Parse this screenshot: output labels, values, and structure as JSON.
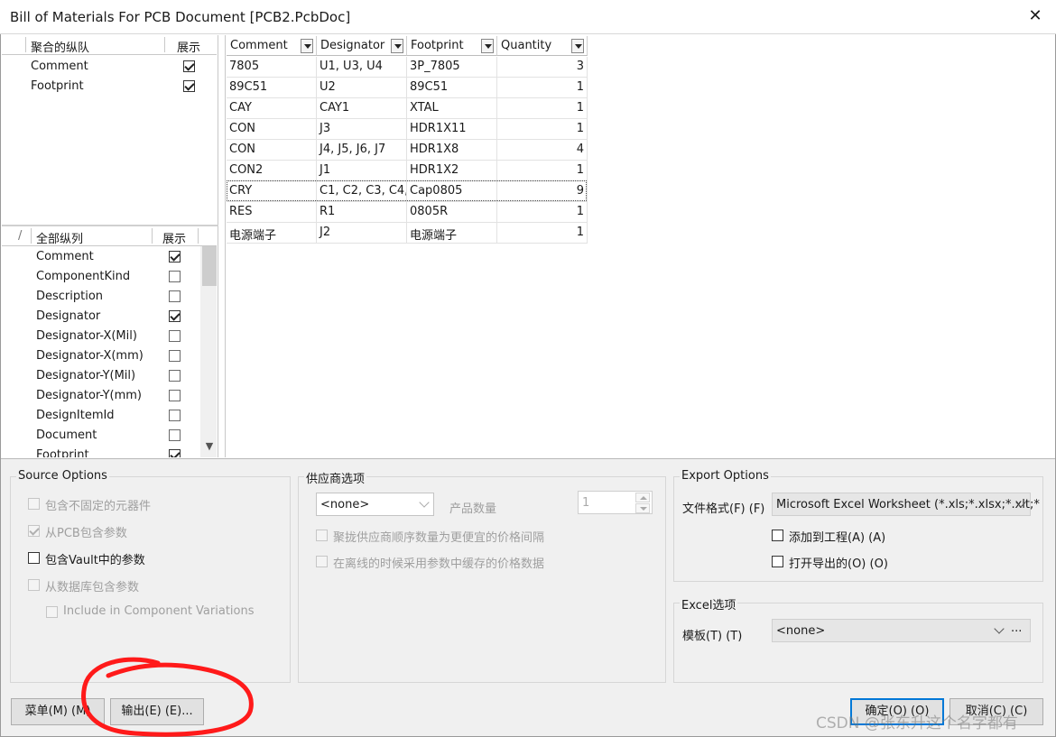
{
  "window": {
    "title": "Bill of Materials For PCB Document [PCB2.PcbDoc]",
    "close_glyph": "✕"
  },
  "aggregated_columns": {
    "header_name": "聚合的纵队",
    "header_show": "展示",
    "items": [
      {
        "label": "Comment",
        "checked": true
      },
      {
        "label": "Footprint",
        "checked": true
      }
    ]
  },
  "all_columns": {
    "sort_glyph": "/",
    "header_name": "全部纵列",
    "header_show": "展示",
    "items": [
      {
        "label": "Comment",
        "checked": true
      },
      {
        "label": "ComponentKind",
        "checked": false
      },
      {
        "label": "Description",
        "checked": false
      },
      {
        "label": "Designator",
        "checked": true
      },
      {
        "label": "Designator-X(Mil)",
        "checked": false
      },
      {
        "label": "Designator-X(mm)",
        "checked": false
      },
      {
        "label": "Designator-Y(Mil)",
        "checked": false
      },
      {
        "label": "Designator-Y(mm)",
        "checked": false
      },
      {
        "label": "DesignItemId",
        "checked": false
      },
      {
        "label": "Document",
        "checked": false
      },
      {
        "label": "Footprint",
        "checked": true
      }
    ]
  },
  "grid": {
    "columns": [
      "Comment",
      "Designator",
      "Footprint",
      "Quantity"
    ],
    "selected_row": 6,
    "rows": [
      [
        "7805",
        "U1, U3, U4",
        "3P_7805",
        "3"
      ],
      [
        "89C51",
        "U2",
        "89C51",
        "1"
      ],
      [
        "CAY",
        "CAY1",
        "XTAL",
        "1"
      ],
      [
        "CON",
        "J3",
        "HDR1X11",
        "1"
      ],
      [
        "CON",
        "J4, J5, J6, J7",
        "HDR1X8",
        "4"
      ],
      [
        "CON2",
        "J1",
        "HDR1X2",
        "1"
      ],
      [
        "CRY",
        "C1, C2, C3, C4,",
        "Cap0805",
        "9"
      ],
      [
        "RES",
        "R1",
        "0805R",
        "1"
      ],
      [
        "电源端子",
        "J2",
        "电源端子",
        "1"
      ]
    ]
  },
  "source_options": {
    "title": "Source Options",
    "opt1": "包含不固定的元器件",
    "opt2": "从PCB包含参数",
    "opt3": "包含Vault中的参数",
    "opt4": "从数据库包含参数",
    "opt5": "Include in Component Variations"
  },
  "supplier_options": {
    "title": "供应商选项",
    "combo_value": "<none>",
    "qty_label": "产品数量",
    "qty_value": "1",
    "opt1": "聚拢供应商顺序数量为更便宜的价格间隔",
    "opt2": "在离线的时候采用参数中缓存的价格数据"
  },
  "export_options": {
    "title": "Export Options",
    "format_label": "文件格式(F) (F)",
    "format_value": "Microsoft Excel Worksheet (*.xls;*.xlsx;*.xlt;*",
    "add_to_project": "添加到工程(A) (A)",
    "open_exported": "打开导出的(O) (O)"
  },
  "excel_options": {
    "title": "Excel选项",
    "template_label": "模板(T) (T)",
    "template_value": "<none>",
    "more_glyph": "···"
  },
  "buttons": {
    "menu": "菜单(M) (M)",
    "export": "输出(E) (E)...",
    "ok": "确定(O) (O)",
    "cancel": "取消(C) (C)"
  },
  "watermark": "CSDN @张东升这个名字都有",
  "colors": {
    "primary_border": "#0078d7",
    "annotation_red": "#ff1a1a"
  }
}
